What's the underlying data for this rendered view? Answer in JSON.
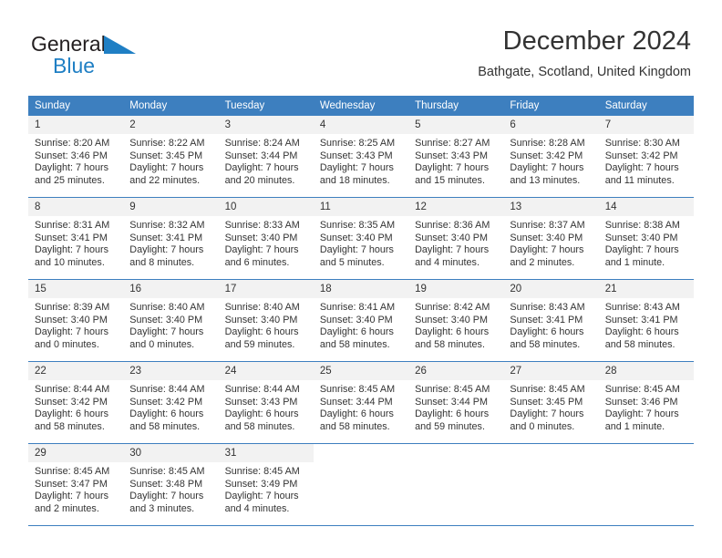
{
  "brand": {
    "name_part1": "General",
    "name_part2": "Blue",
    "triangle_icon": "blue-triangle-icon",
    "accent_color": "#1f7fc4"
  },
  "header": {
    "title": "December 2024",
    "subtitle": "Bathgate, Scotland, United Kingdom"
  },
  "calendar": {
    "header_bg": "#3d7fbf",
    "daynum_bg": "#f2f2f2",
    "weekday_headers": [
      "Sunday",
      "Monday",
      "Tuesday",
      "Wednesday",
      "Thursday",
      "Friday",
      "Saturday"
    ],
    "weeks": [
      [
        {
          "day": "1",
          "sunrise": "Sunrise: 8:20 AM",
          "sunset": "Sunset: 3:46 PM",
          "daylight_line1": "Daylight: 7 hours",
          "daylight_line2": "and 25 minutes."
        },
        {
          "day": "2",
          "sunrise": "Sunrise: 8:22 AM",
          "sunset": "Sunset: 3:45 PM",
          "daylight_line1": "Daylight: 7 hours",
          "daylight_line2": "and 22 minutes."
        },
        {
          "day": "3",
          "sunrise": "Sunrise: 8:24 AM",
          "sunset": "Sunset: 3:44 PM",
          "daylight_line1": "Daylight: 7 hours",
          "daylight_line2": "and 20 minutes."
        },
        {
          "day": "4",
          "sunrise": "Sunrise: 8:25 AM",
          "sunset": "Sunset: 3:43 PM",
          "daylight_line1": "Daylight: 7 hours",
          "daylight_line2": "and 18 minutes."
        },
        {
          "day": "5",
          "sunrise": "Sunrise: 8:27 AM",
          "sunset": "Sunset: 3:43 PM",
          "daylight_line1": "Daylight: 7 hours",
          "daylight_line2": "and 15 minutes."
        },
        {
          "day": "6",
          "sunrise": "Sunrise: 8:28 AM",
          "sunset": "Sunset: 3:42 PM",
          "daylight_line1": "Daylight: 7 hours",
          "daylight_line2": "and 13 minutes."
        },
        {
          "day": "7",
          "sunrise": "Sunrise: 8:30 AM",
          "sunset": "Sunset: 3:42 PM",
          "daylight_line1": "Daylight: 7 hours",
          "daylight_line2": "and 11 minutes."
        }
      ],
      [
        {
          "day": "8",
          "sunrise": "Sunrise: 8:31 AM",
          "sunset": "Sunset: 3:41 PM",
          "daylight_line1": "Daylight: 7 hours",
          "daylight_line2": "and 10 minutes."
        },
        {
          "day": "9",
          "sunrise": "Sunrise: 8:32 AM",
          "sunset": "Sunset: 3:41 PM",
          "daylight_line1": "Daylight: 7 hours",
          "daylight_line2": "and 8 minutes."
        },
        {
          "day": "10",
          "sunrise": "Sunrise: 8:33 AM",
          "sunset": "Sunset: 3:40 PM",
          "daylight_line1": "Daylight: 7 hours",
          "daylight_line2": "and 6 minutes."
        },
        {
          "day": "11",
          "sunrise": "Sunrise: 8:35 AM",
          "sunset": "Sunset: 3:40 PM",
          "daylight_line1": "Daylight: 7 hours",
          "daylight_line2": "and 5 minutes."
        },
        {
          "day": "12",
          "sunrise": "Sunrise: 8:36 AM",
          "sunset": "Sunset: 3:40 PM",
          "daylight_line1": "Daylight: 7 hours",
          "daylight_line2": "and 4 minutes."
        },
        {
          "day": "13",
          "sunrise": "Sunrise: 8:37 AM",
          "sunset": "Sunset: 3:40 PM",
          "daylight_line1": "Daylight: 7 hours",
          "daylight_line2": "and 2 minutes."
        },
        {
          "day": "14",
          "sunrise": "Sunrise: 8:38 AM",
          "sunset": "Sunset: 3:40 PM",
          "daylight_line1": "Daylight: 7 hours",
          "daylight_line2": "and 1 minute."
        }
      ],
      [
        {
          "day": "15",
          "sunrise": "Sunrise: 8:39 AM",
          "sunset": "Sunset: 3:40 PM",
          "daylight_line1": "Daylight: 7 hours",
          "daylight_line2": "and 0 minutes."
        },
        {
          "day": "16",
          "sunrise": "Sunrise: 8:40 AM",
          "sunset": "Sunset: 3:40 PM",
          "daylight_line1": "Daylight: 7 hours",
          "daylight_line2": "and 0 minutes."
        },
        {
          "day": "17",
          "sunrise": "Sunrise: 8:40 AM",
          "sunset": "Sunset: 3:40 PM",
          "daylight_line1": "Daylight: 6 hours",
          "daylight_line2": "and 59 minutes."
        },
        {
          "day": "18",
          "sunrise": "Sunrise: 8:41 AM",
          "sunset": "Sunset: 3:40 PM",
          "daylight_line1": "Daylight: 6 hours",
          "daylight_line2": "and 58 minutes."
        },
        {
          "day": "19",
          "sunrise": "Sunrise: 8:42 AM",
          "sunset": "Sunset: 3:40 PM",
          "daylight_line1": "Daylight: 6 hours",
          "daylight_line2": "and 58 minutes."
        },
        {
          "day": "20",
          "sunrise": "Sunrise: 8:43 AM",
          "sunset": "Sunset: 3:41 PM",
          "daylight_line1": "Daylight: 6 hours",
          "daylight_line2": "and 58 minutes."
        },
        {
          "day": "21",
          "sunrise": "Sunrise: 8:43 AM",
          "sunset": "Sunset: 3:41 PM",
          "daylight_line1": "Daylight: 6 hours",
          "daylight_line2": "and 58 minutes."
        }
      ],
      [
        {
          "day": "22",
          "sunrise": "Sunrise: 8:44 AM",
          "sunset": "Sunset: 3:42 PM",
          "daylight_line1": "Daylight: 6 hours",
          "daylight_line2": "and 58 minutes."
        },
        {
          "day": "23",
          "sunrise": "Sunrise: 8:44 AM",
          "sunset": "Sunset: 3:42 PM",
          "daylight_line1": "Daylight: 6 hours",
          "daylight_line2": "and 58 minutes."
        },
        {
          "day": "24",
          "sunrise": "Sunrise: 8:44 AM",
          "sunset": "Sunset: 3:43 PM",
          "daylight_line1": "Daylight: 6 hours",
          "daylight_line2": "and 58 minutes."
        },
        {
          "day": "25",
          "sunrise": "Sunrise: 8:45 AM",
          "sunset": "Sunset: 3:44 PM",
          "daylight_line1": "Daylight: 6 hours",
          "daylight_line2": "and 58 minutes."
        },
        {
          "day": "26",
          "sunrise": "Sunrise: 8:45 AM",
          "sunset": "Sunset: 3:44 PM",
          "daylight_line1": "Daylight: 6 hours",
          "daylight_line2": "and 59 minutes."
        },
        {
          "day": "27",
          "sunrise": "Sunrise: 8:45 AM",
          "sunset": "Sunset: 3:45 PM",
          "daylight_line1": "Daylight: 7 hours",
          "daylight_line2": "and 0 minutes."
        },
        {
          "day": "28",
          "sunrise": "Sunrise: 8:45 AM",
          "sunset": "Sunset: 3:46 PM",
          "daylight_line1": "Daylight: 7 hours",
          "daylight_line2": "and 1 minute."
        }
      ],
      [
        {
          "day": "29",
          "sunrise": "Sunrise: 8:45 AM",
          "sunset": "Sunset: 3:47 PM",
          "daylight_line1": "Daylight: 7 hours",
          "daylight_line2": "and 2 minutes."
        },
        {
          "day": "30",
          "sunrise": "Sunrise: 8:45 AM",
          "sunset": "Sunset: 3:48 PM",
          "daylight_line1": "Daylight: 7 hours",
          "daylight_line2": "and 3 minutes."
        },
        {
          "day": "31",
          "sunrise": "Sunrise: 8:45 AM",
          "sunset": "Sunset: 3:49 PM",
          "daylight_line1": "Daylight: 7 hours",
          "daylight_line2": "and 4 minutes."
        },
        {
          "day": "",
          "sunrise": "",
          "sunset": "",
          "daylight_line1": "",
          "daylight_line2": ""
        },
        {
          "day": "",
          "sunrise": "",
          "sunset": "",
          "daylight_line1": "",
          "daylight_line2": ""
        },
        {
          "day": "",
          "sunrise": "",
          "sunset": "",
          "daylight_line1": "",
          "daylight_line2": ""
        },
        {
          "day": "",
          "sunrise": "",
          "sunset": "",
          "daylight_line1": "",
          "daylight_line2": ""
        }
      ]
    ]
  }
}
